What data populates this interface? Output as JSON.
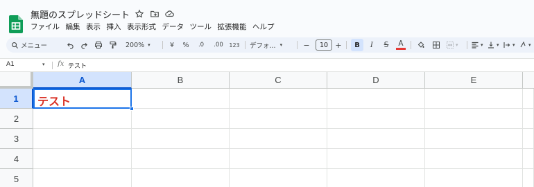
{
  "app": {
    "doc_title": "無題のスプレッドシート",
    "brand_color": "#0f9d58",
    "title_icons": [
      "star-icon",
      "move-to-folder-icon",
      "cloud-status-icon"
    ]
  },
  "menu": [
    "ファイル",
    "編集",
    "表示",
    "挿入",
    "表示形式",
    "データ",
    "ツール",
    "拡張機能",
    "ヘルプ"
  ],
  "toolbar": {
    "search_label": "メニュー",
    "zoom": "200%",
    "currency": "¥",
    "percent": "%",
    "decimal_decrease": ".0",
    "decimal_increase": ".00",
    "number_format": "123",
    "font_family": "デフォ...",
    "minus": "−",
    "font_size": "10",
    "plus": "+",
    "bold": "B",
    "italic": "I",
    "strikethrough": "S",
    "text_color_label": "A",
    "text_color": "#e53935"
  },
  "formula_bar": {
    "cell_ref": "A1",
    "fx": "fx",
    "value": "テスト"
  },
  "grid": {
    "columns": [
      "A",
      "B",
      "C",
      "D",
      "E"
    ],
    "rows": [
      "1",
      "2",
      "3",
      "4",
      "5"
    ],
    "selected_column": "A",
    "selected_row": "1",
    "a1_value": "テスト",
    "a1_color": "#d93025",
    "selection_color": "#1a73e8"
  }
}
